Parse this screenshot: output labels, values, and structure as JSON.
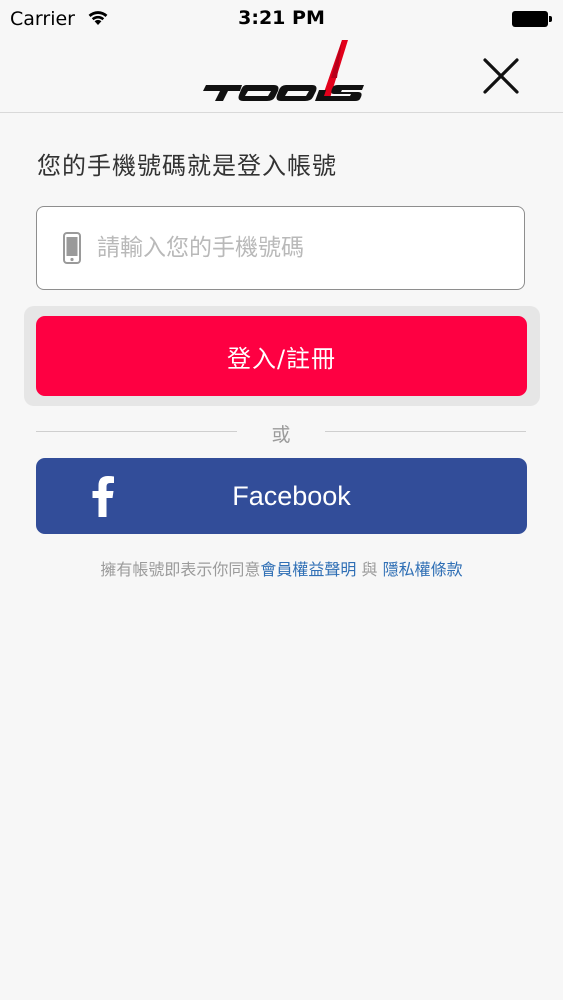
{
  "status_bar": {
    "carrier": "Carrier",
    "time": "3:21 PM"
  },
  "nav": {
    "logo_text": "TOOLS",
    "close_icon": "close-icon"
  },
  "login": {
    "title": "您的手機號碼就是登入帳號",
    "phone_placeholder": "請輸入您的手機號碼",
    "phone_value": "",
    "login_button": "登入/註冊",
    "divider": "或",
    "facebook_button": "Facebook"
  },
  "terms": {
    "prefix": "擁有帳號即表示你同意",
    "member_link": "會員權益聲明",
    "conjunction": " 與 ",
    "privacy_link": "隱私權條款"
  },
  "colors": {
    "brand_red": "#fe0042",
    "facebook_blue": "#324d99",
    "link_blue": "#2f6fb5"
  }
}
